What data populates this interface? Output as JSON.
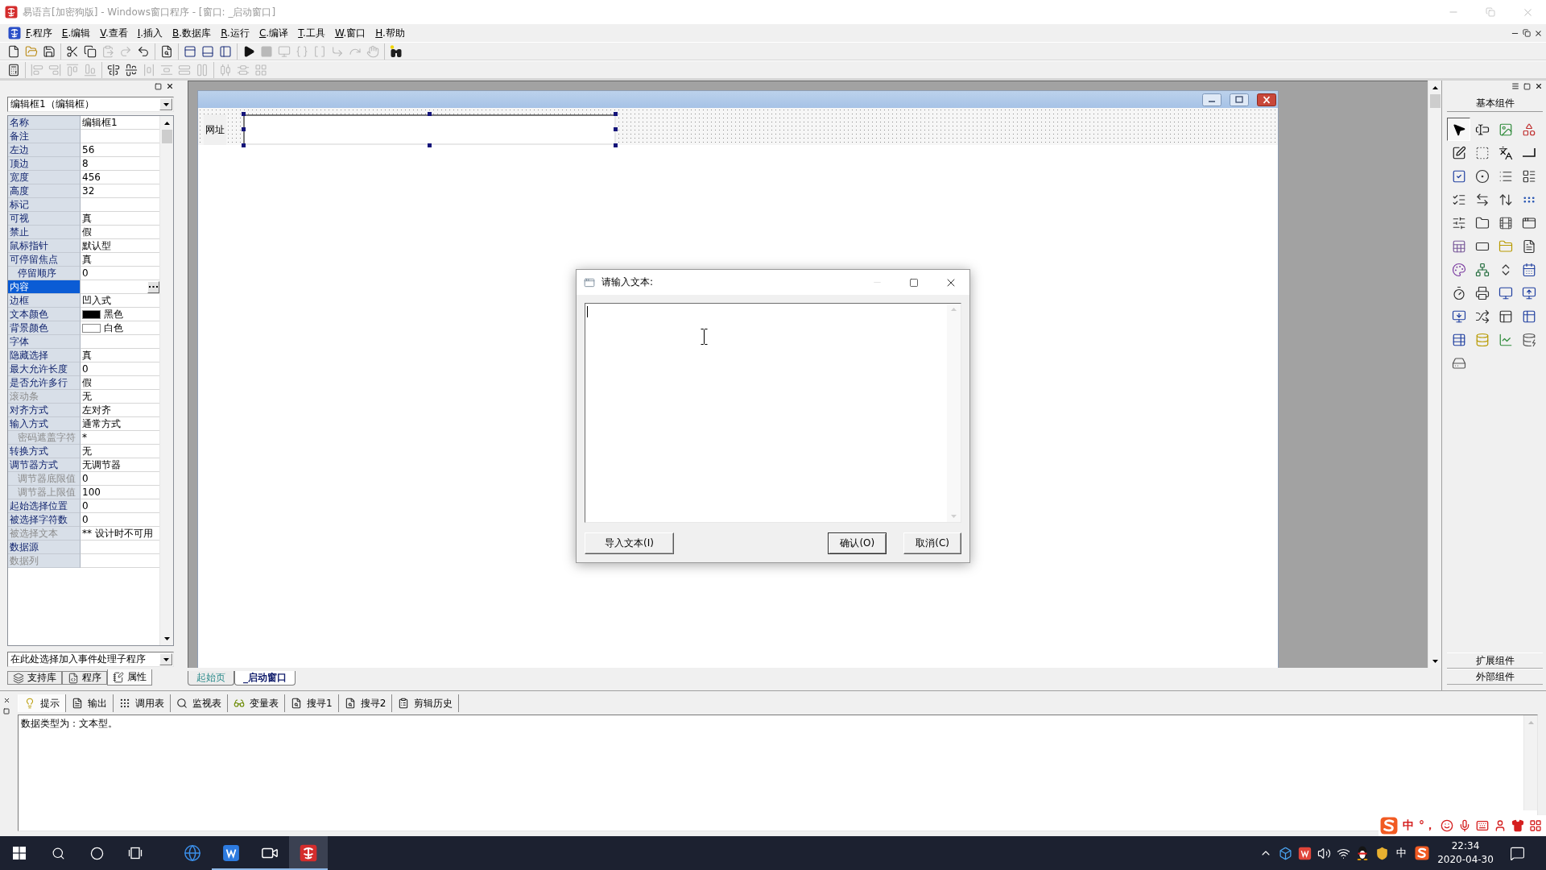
{
  "window": {
    "title": "易语言[加密狗版] - Windows窗口程序 - [窗口: _启动窗口]",
    "active": false
  },
  "menu": [
    {
      "accelerator": "F",
      "label": ".程序"
    },
    {
      "accelerator": "E",
      "label": ".编辑"
    },
    {
      "accelerator": "V",
      "label": ".查看"
    },
    {
      "accelerator": "I",
      "label": ".插入"
    },
    {
      "accelerator": "B",
      "label": ".数据库"
    },
    {
      "accelerator": "R",
      "label": ".运行"
    },
    {
      "accelerator": "C",
      "label": ".编译"
    },
    {
      "accelerator": "T",
      "label": ".工具"
    },
    {
      "accelerator": "W",
      "label": ".窗口"
    },
    {
      "accelerator": "H",
      "label": ".帮助"
    }
  ],
  "toolbars": [
    {
      "groups": [
        [
          {
            "kind": "new",
            "disabled": false
          },
          {
            "kind": "open",
            "disabled": false
          },
          {
            "kind": "save",
            "disabled": false
          }
        ],
        [
          {
            "kind": "cut",
            "disabled": false
          },
          {
            "kind": "copy",
            "disabled": false
          },
          {
            "kind": "paste",
            "disabled": true
          },
          {
            "kind": "redo",
            "disabled": true
          },
          {
            "kind": "undo",
            "disabled": false
          }
        ],
        [
          {
            "kind": "preview",
            "disabled": false
          }
        ],
        [
          {
            "kind": "split1",
            "disabled": false
          },
          {
            "kind": "split2",
            "disabled": false
          },
          {
            "kind": "split3",
            "disabled": false
          }
        ],
        [
          {
            "kind": "run",
            "disabled": false
          },
          {
            "kind": "stop",
            "disabled": true
          },
          {
            "kind": "stepin",
            "disabled": true
          },
          {
            "kind": "stepover",
            "disabled": true
          },
          {
            "kind": "stepout",
            "disabled": true
          },
          {
            "kind": "runto",
            "disabled": true
          },
          {
            "kind": "jump",
            "disabled": true
          },
          {
            "kind": "pause",
            "disabled": true
          }
        ],
        [
          {
            "kind": "find",
            "disabled": false
          }
        ]
      ]
    },
    {
      "groups": [
        [
          {
            "kind": "form",
            "disabled": false
          }
        ],
        [
          {
            "kind": "alignleft",
            "disabled": true
          },
          {
            "kind": "alignright",
            "disabled": true
          },
          {
            "kind": "aligntop",
            "disabled": true
          },
          {
            "kind": "alignbottom",
            "disabled": true
          }
        ],
        [
          {
            "kind": "centerh",
            "disabled": false
          },
          {
            "kind": "centerv",
            "disabled": false
          },
          {
            "kind": "spaceh",
            "disabled": true
          },
          {
            "kind": "spacev",
            "disabled": true
          },
          {
            "kind": "samewidth",
            "disabled": true
          },
          {
            "kind": "sameheight",
            "disabled": true
          }
        ],
        [
          {
            "kind": "distributeh",
            "disabled": true
          },
          {
            "kind": "distributev",
            "disabled": true
          },
          {
            "kind": "samesize",
            "disabled": true
          }
        ]
      ]
    }
  ],
  "properties_panel": {
    "object_selector": "编辑框1（编辑框）",
    "properties": [
      {
        "name": "名称",
        "value": "编辑框1",
        "kind": "text",
        "disabled": false,
        "selected": false
      },
      {
        "name": "备注",
        "kind": "text",
        "disabled": false,
        "selected": false
      },
      {
        "name": "左边",
        "value": "56",
        "kind": "text",
        "disabled": false,
        "selected": false
      },
      {
        "name": "顶边",
        "value": "8",
        "kind": "text",
        "disabled": false,
        "selected": false
      },
      {
        "name": "宽度",
        "value": "456",
        "kind": "text",
        "disabled": false,
        "selected": false
      },
      {
        "name": "高度",
        "value": "32",
        "kind": "text",
        "disabled": false,
        "selected": false
      },
      {
        "name": "标记",
        "kind": "text",
        "disabled": false,
        "selected": false
      },
      {
        "name": "可视",
        "value": "真",
        "kind": "text",
        "disabled": false,
        "selected": false
      },
      {
        "name": "禁止",
        "value": "假",
        "kind": "text",
        "disabled": false,
        "selected": false
      },
      {
        "name": "鼠标指针",
        "value": "默认型",
        "kind": "text",
        "disabled": false,
        "selected": false
      },
      {
        "name": "可停留焦点",
        "value": "真",
        "kind": "text",
        "disabled": false,
        "selected": false,
        "children": [
          {
            "name": "停留顺序",
            "value": "0",
            "kind": "text",
            "disabled": false,
            "selected": false
          }
        ]
      },
      {
        "name": "内容",
        "kind": "text",
        "disabled": false,
        "selected": true
      },
      {
        "name": "边框",
        "value": "凹入式",
        "kind": "text",
        "disabled": false,
        "selected": false
      },
      {
        "name": "文本颜色",
        "value": "黑色",
        "kind": "color",
        "color": "#000000",
        "disabled": false,
        "selected": false
      },
      {
        "name": "背景颜色",
        "value": "白色",
        "kind": "color",
        "color": "#ffffff",
        "disabled": false,
        "selected": false
      },
      {
        "name": "字体",
        "kind": "text",
        "disabled": false,
        "selected": false
      },
      {
        "name": "隐藏选择",
        "value": "真",
        "kind": "text",
        "disabled": false,
        "selected": false
      },
      {
        "name": "最大允许长度",
        "value": "0",
        "kind": "text",
        "disabled": false,
        "selected": false
      },
      {
        "name": "是否允许多行",
        "value": "假",
        "kind": "text",
        "disabled": false,
        "selected": false
      },
      {
        "name": "滚动条",
        "value": "无",
        "kind": "text",
        "disabled": true,
        "selected": false
      },
      {
        "name": "对齐方式",
        "value": "左对齐",
        "kind": "text",
        "disabled": false,
        "selected": false
      },
      {
        "name": "输入方式",
        "value": "通常方式",
        "kind": "text",
        "disabled": false,
        "selected": false,
        "children": [
          {
            "name": "密码遮盖字符",
            "value": "*",
            "kind": "text",
            "disabled": true,
            "selected": false
          }
        ]
      },
      {
        "name": "转换方式",
        "value": "无",
        "kind": "text",
        "disabled": false,
        "selected": false
      },
      {
        "name": "调节器方式",
        "value": "无调节器",
        "kind": "text",
        "disabled": false,
        "selected": false,
        "children": [
          {
            "name": "调节器底限值",
            "value": "0",
            "kind": "text",
            "disabled": true,
            "selected": false
          },
          {
            "name": "调节器上限值",
            "value": "100",
            "kind": "text",
            "disabled": true,
            "selected": false
          }
        ]
      },
      {
        "name": "起始选择位置",
        "value": "0",
        "kind": "text",
        "disabled": false,
        "selected": false
      },
      {
        "name": "被选择字符数",
        "value": "0",
        "kind": "text",
        "disabled": false,
        "selected": false
      },
      {
        "name": "被选择文本",
        "value": "** 设计时不可用",
        "kind": "text",
        "disabled": true,
        "selected": false
      },
      {
        "name": "数据源",
        "kind": "text",
        "disabled": false,
        "selected": false
      },
      {
        "name": "数据列",
        "kind": "text",
        "disabled": true,
        "selected": false
      }
    ],
    "event_selector": "在此处选择加入事件处理子程序",
    "tabs": [
      {
        "kind": "library",
        "label": "支持库",
        "selected": false
      },
      {
        "kind": "program",
        "label": "程序",
        "selected": false
      },
      {
        "kind": "property",
        "label": "属性",
        "selected": true
      }
    ]
  },
  "editor": {
    "form": {
      "controls": [
        {
          "kind": "label",
          "text": "网址",
          "selected": false
        },
        {
          "kind": "edit",
          "selected": true
        }
      ]
    },
    "tabs": [
      {
        "label": "起始页",
        "selected": false
      },
      {
        "label": "_启动窗口",
        "selected": true
      }
    ]
  },
  "components_panel": {
    "title": "基本组件",
    "items": [
      {
        "kind": "pointer",
        "selected": true
      },
      {
        "kind": "label",
        "selected": false
      },
      {
        "kind": "picture",
        "selected": false
      },
      {
        "kind": "shape",
        "selected": false
      },
      {
        "kind": "edit",
        "selected": false
      },
      {
        "kind": "frame",
        "selected": false
      },
      {
        "kind": "char",
        "selected": false
      },
      {
        "kind": "line",
        "selected": false
      },
      {
        "kind": "checkbox",
        "selected": false
      },
      {
        "kind": "radio",
        "selected": false
      },
      {
        "kind": "combo",
        "selected": false
      },
      {
        "kind": "listbox",
        "selected": false
      },
      {
        "kind": "checklist",
        "selected": false
      },
      {
        "kind": "hscroll",
        "selected": false
      },
      {
        "kind": "vscroll",
        "selected": false
      },
      {
        "kind": "progress",
        "selected": false
      },
      {
        "kind": "slider",
        "selected": false
      },
      {
        "kind": "tab",
        "selected": false
      },
      {
        "kind": "animation",
        "selected": false
      },
      {
        "kind": "browser",
        "selected": false
      },
      {
        "kind": "table",
        "selected": false
      },
      {
        "kind": "button",
        "selected": false
      },
      {
        "kind": "dir",
        "selected": false
      },
      {
        "kind": "file",
        "selected": false
      },
      {
        "kind": "color",
        "selected": false
      },
      {
        "kind": "net",
        "selected": false
      },
      {
        "kind": "spin",
        "selected": false
      },
      {
        "kind": "calendar",
        "selected": false
      },
      {
        "kind": "timer",
        "selected": false
      },
      {
        "kind": "printer",
        "selected": false
      },
      {
        "kind": "server",
        "selected": false
      },
      {
        "kind": "client",
        "selected": false
      },
      {
        "kind": "link",
        "selected": false
      },
      {
        "kind": "port",
        "selected": false
      },
      {
        "kind": "window",
        "selected": false
      },
      {
        "kind": "toolbar",
        "selected": false
      },
      {
        "kind": "recordset",
        "selected": false
      },
      {
        "kind": "database",
        "selected": false
      },
      {
        "kind": "chart",
        "selected": false
      },
      {
        "kind": "odbc",
        "selected": false
      },
      {
        "kind": "odbc2",
        "selected": false
      }
    ],
    "sections": [
      "扩展组件",
      "外部组件"
    ]
  },
  "bottom_panel": {
    "tabs": [
      {
        "kind": "hint",
        "label": "提示",
        "selected": true
      },
      {
        "kind": "output",
        "label": "输出",
        "selected": false
      },
      {
        "kind": "calls",
        "label": "调用表",
        "selected": false
      },
      {
        "kind": "watch",
        "label": "监视表",
        "selected": false
      },
      {
        "kind": "vars",
        "label": "变量表",
        "selected": false
      },
      {
        "kind": "search",
        "label": "搜寻1",
        "selected": false
      },
      {
        "kind": "search",
        "label": "搜寻2",
        "selected": false
      },
      {
        "kind": "clipboard",
        "label": "剪辑历史",
        "selected": false
      }
    ],
    "text": "数据类型为：文本型。"
  },
  "dialog": {
    "title": "请输入文本:",
    "text_field": {
      "focused": true
    },
    "buttons": [
      {
        "label": "导入文本(I)",
        "default": false
      },
      {
        "label": "确认(O)",
        "default": true
      },
      {
        "label": "取消(C)",
        "default": false
      }
    ]
  },
  "ime_bar": {
    "mode": "中",
    "punctuation": "°，"
  },
  "taskbar": {
    "apps": [
      {
        "kind": "browser",
        "running": false,
        "active": false
      },
      {
        "kind": "writer",
        "running": true,
        "active": false
      },
      {
        "kind": "camera",
        "running": true,
        "active": false
      },
      {
        "kind": "ide",
        "running": true,
        "active": true
      }
    ],
    "input_mode": "中",
    "clock": {
      "time": "22:34",
      "date": "2020-04-30"
    }
  }
}
